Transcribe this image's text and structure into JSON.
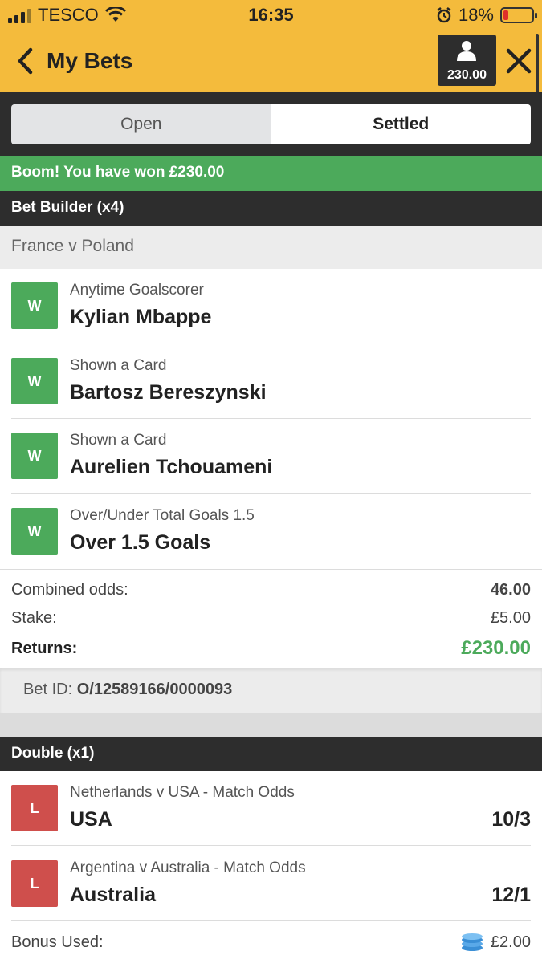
{
  "status_bar": {
    "carrier": "TESCO",
    "time": "16:35",
    "battery": "18%",
    "battery_level": 0.18
  },
  "header": {
    "title": "My Bets",
    "balance": "230.00"
  },
  "tabs": [
    {
      "label": "Open",
      "active": false
    },
    {
      "label": "Settled",
      "active": true
    }
  ],
  "win_banner": "Boom! You have won £230.00",
  "bet1": {
    "type": "Bet Builder (x4)",
    "match": "France v Poland",
    "selections": [
      {
        "result": "W",
        "market": "Anytime Goalscorer",
        "name": "Kylian Mbappe"
      },
      {
        "result": "W",
        "market": "Shown a Card",
        "name": "Bartosz Bereszynski"
      },
      {
        "result": "W",
        "market": "Shown a Card",
        "name": "Aurelien Tchouameni"
      },
      {
        "result": "W",
        "market": "Over/Under Total Goals 1.5",
        "name": "Over 1.5 Goals"
      }
    ],
    "combined_odds_label": "Combined odds:",
    "combined_odds": "46.00",
    "stake_label": "Stake:",
    "stake": "£5.00",
    "returns_label": "Returns:",
    "returns": "£230.00",
    "bet_id_label": "Bet ID:",
    "bet_id": "O/12589166/0000093"
  },
  "bet2": {
    "type": "Double (x1)",
    "selections": [
      {
        "result": "L",
        "market": "Netherlands v USA - Match Odds",
        "name": "USA",
        "odds": "10/3"
      },
      {
        "result": "L",
        "market": "Argentina v Australia - Match Odds",
        "name": "Australia",
        "odds": "12/1"
      }
    ],
    "bonus_label": "Bonus Used:",
    "bonus_value": "£2.00"
  },
  "colors": {
    "brand": "#f4bb3c",
    "win": "#4caa5b",
    "loss": "#cf4f4c",
    "dark": "#2d2d2d"
  }
}
